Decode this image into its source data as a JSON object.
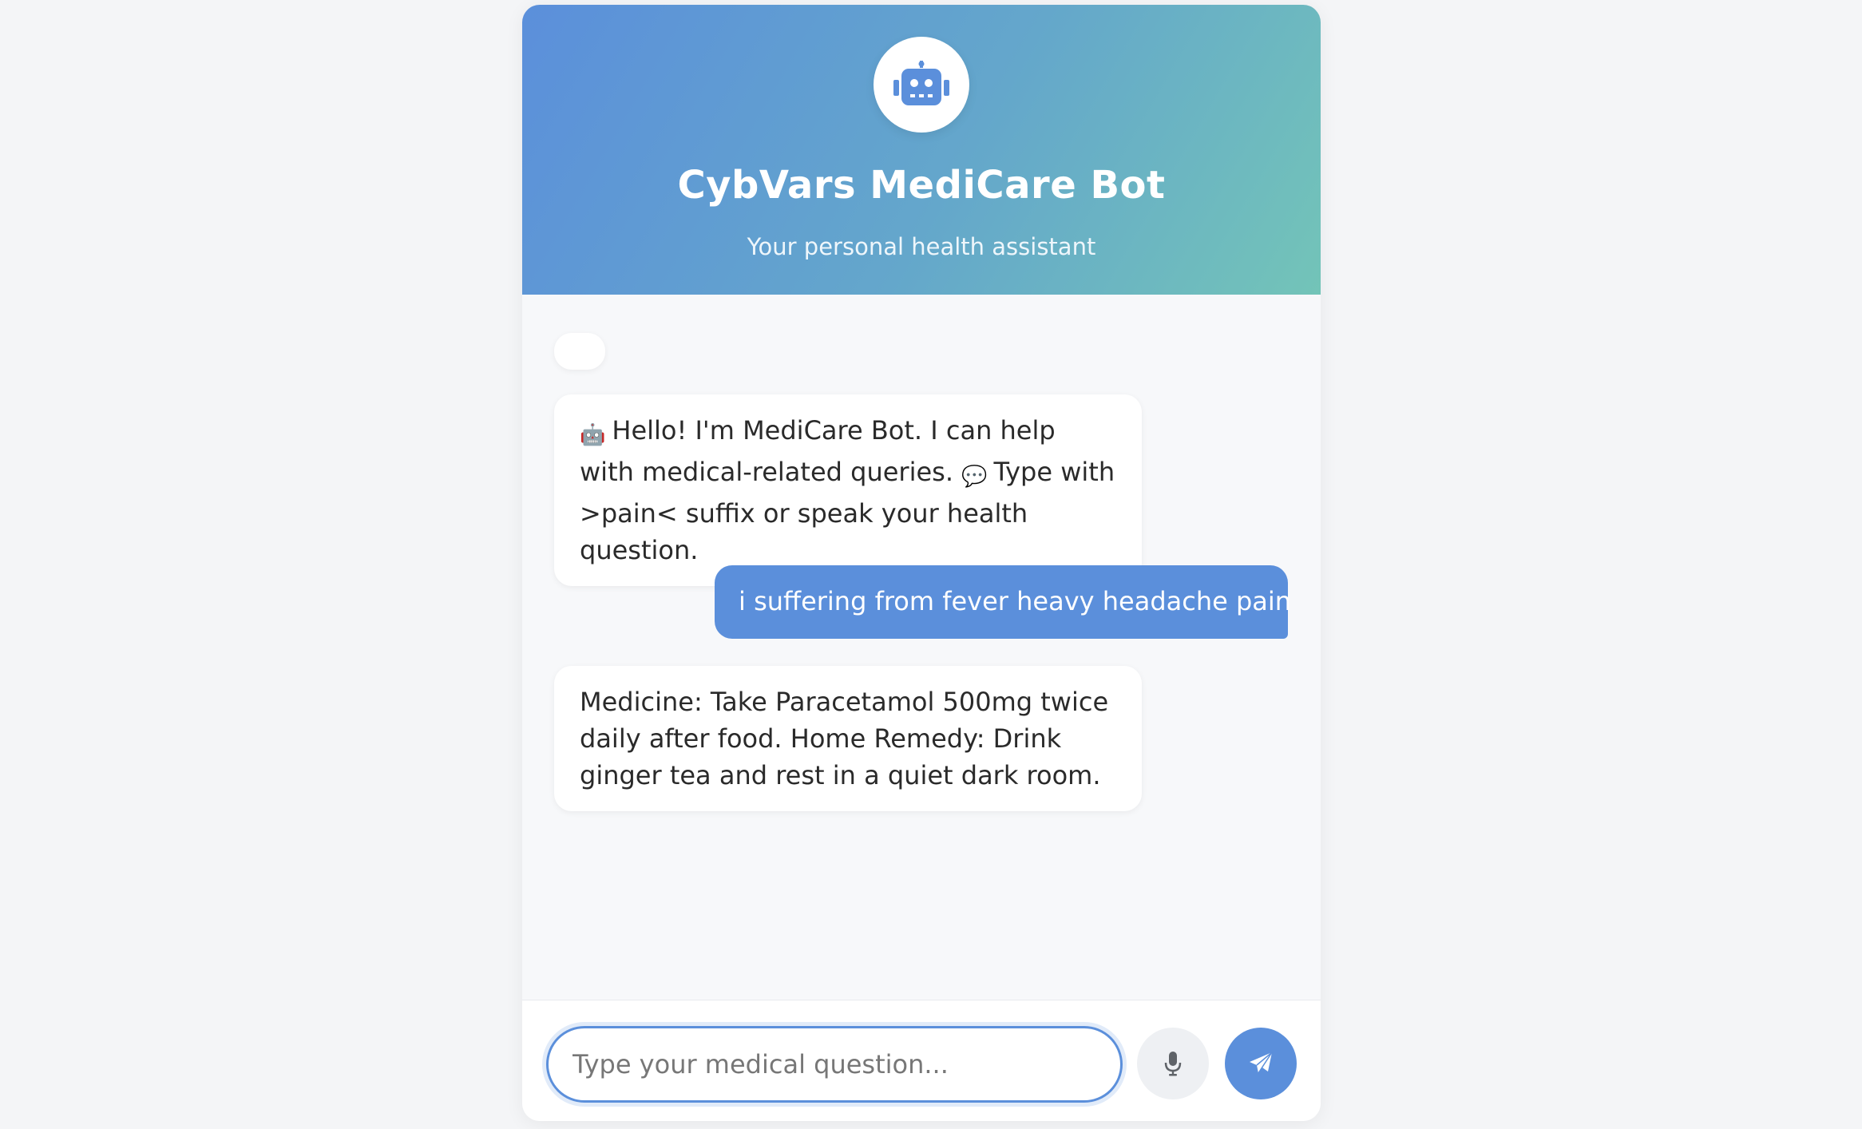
{
  "header": {
    "title": "CybVars MediCare Bot",
    "subtitle": "Your personal health assistant",
    "avatar_icon": "robot-icon"
  },
  "messages": [
    {
      "from": "bot",
      "text": ""
    },
    {
      "from": "bot",
      "emoji_1": "🤖",
      "text_1": "Hello! I'm MediCare Bot. I can help with medical-related queries.",
      "emoji_2": "💬",
      "text_2": "Type with >pain< suffix or speak your health question."
    },
    {
      "from": "user",
      "text": "i suffering from fever heavy headache pain"
    },
    {
      "from": "bot",
      "text": "Medicine: Take Paracetamol 500mg twice daily after food. Home Remedy: Drink ginger tea and rest in a quiet dark room."
    }
  ],
  "composer": {
    "placeholder": "Type your medical question...",
    "value": "",
    "mic_icon": "microphone-icon",
    "send_icon": "paper-plane-icon"
  },
  "colors": {
    "accent": "#5b8fdb",
    "gradient_start": "#5b8fdb",
    "gradient_end": "#73c4b8"
  }
}
